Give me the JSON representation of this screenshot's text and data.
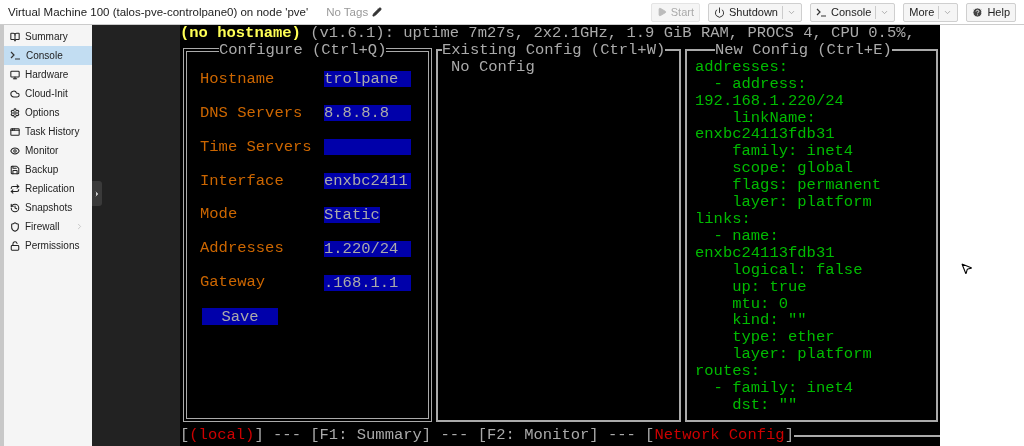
{
  "window": {
    "title": "Virtual Machine 100 (talos-pve-controlpane0) on node 'pve'",
    "tags": "No Tags"
  },
  "toolbar": [
    {
      "label": "Start",
      "kind": "play",
      "disabled": true,
      "dropdown": false
    },
    {
      "label": "Shutdown",
      "kind": "power",
      "disabled": false,
      "dropdown": true
    },
    {
      "label": "Console",
      "kind": "terminal",
      "disabled": false,
      "dropdown": true
    },
    {
      "label": "More",
      "kind": "none",
      "disabled": false,
      "dropdown": true
    },
    {
      "label": "Help",
      "kind": "help",
      "disabled": false,
      "dropdown": false
    }
  ],
  "sidebar": {
    "items": [
      {
        "label": "Summary",
        "selected": false,
        "expandable": false
      },
      {
        "label": "Console",
        "selected": true,
        "expandable": false
      },
      {
        "label": "Hardware",
        "selected": false,
        "expandable": false
      },
      {
        "label": "Cloud-Init",
        "selected": false,
        "expandable": false
      },
      {
        "label": "Options",
        "selected": false,
        "expandable": false
      },
      {
        "label": "Task History",
        "selected": false,
        "expandable": false
      },
      {
        "label": "Monitor",
        "selected": false,
        "expandable": false
      },
      {
        "label": "Backup",
        "selected": false,
        "expandable": false
      },
      {
        "label": "Replication",
        "selected": false,
        "expandable": false
      },
      {
        "label": "Snapshots",
        "selected": false,
        "expandable": false
      },
      {
        "label": "Firewall",
        "selected": false,
        "expandable": true
      },
      {
        "label": "Permissions",
        "selected": false,
        "expandable": false
      }
    ]
  },
  "terminal": {
    "header": {
      "hostname": "(no hostname)",
      "info": "(v1.6.1): uptime 7m27s, 2x2.1GHz, 1.9 GiB RAM, PROCS 4, CPU 0.5%,"
    },
    "configure": {
      "title": "Configure (Ctrl+Q)",
      "fields": [
        {
          "label": "Hostname",
          "value": "trolpane",
          "kind": "input"
        },
        {
          "label": "DNS Servers",
          "value": "8.8.8.8",
          "kind": "input"
        },
        {
          "label": "Time Servers",
          "kind": "input"
        },
        {
          "label": "Interface",
          "value": "enxbc2411",
          "kind": "input"
        },
        {
          "label": "Mode",
          "value": "Static",
          "kind": "select"
        },
        {
          "label": "Addresses",
          "value": "1.220/24",
          "kind": "input"
        },
        {
          "label": "Gateway",
          "value": ".168.1.1",
          "kind": "input"
        }
      ],
      "button": "Save"
    },
    "existing": {
      "title": "Existing Config (Ctrl+W)",
      "text": "No Config"
    },
    "new": {
      "title": "New Config (Ctrl+E)",
      "lines": [
        "addresses:",
        "  - address:",
        "192.168.1.220/24",
        "    linkName:",
        "enxbc24113fdb31",
        "    family: inet4",
        "    scope: global",
        "    flags: permanent",
        "    layer: platform",
        "links:",
        "  - name:",
        "enxbc24113fdb31",
        "    logical: false",
        "    up: true",
        "    mtu: 0",
        "    kind: \"\"",
        "    type: ether",
        "    layer: platform",
        "routes:",
        "  - family: inet4",
        "    dst: \"\""
      ]
    },
    "status": [
      {
        "text": "[",
        "highlighted": false
      },
      {
        "text": "(local)",
        "highlighted": true
      },
      {
        "text": "] --- [F1: Summary] --- [F2: Monitor] --- [",
        "highlighted": false
      },
      {
        "text": "Network Config",
        "highlighted": true
      },
      {
        "text": "]",
        "highlighted": false
      }
    ]
  }
}
